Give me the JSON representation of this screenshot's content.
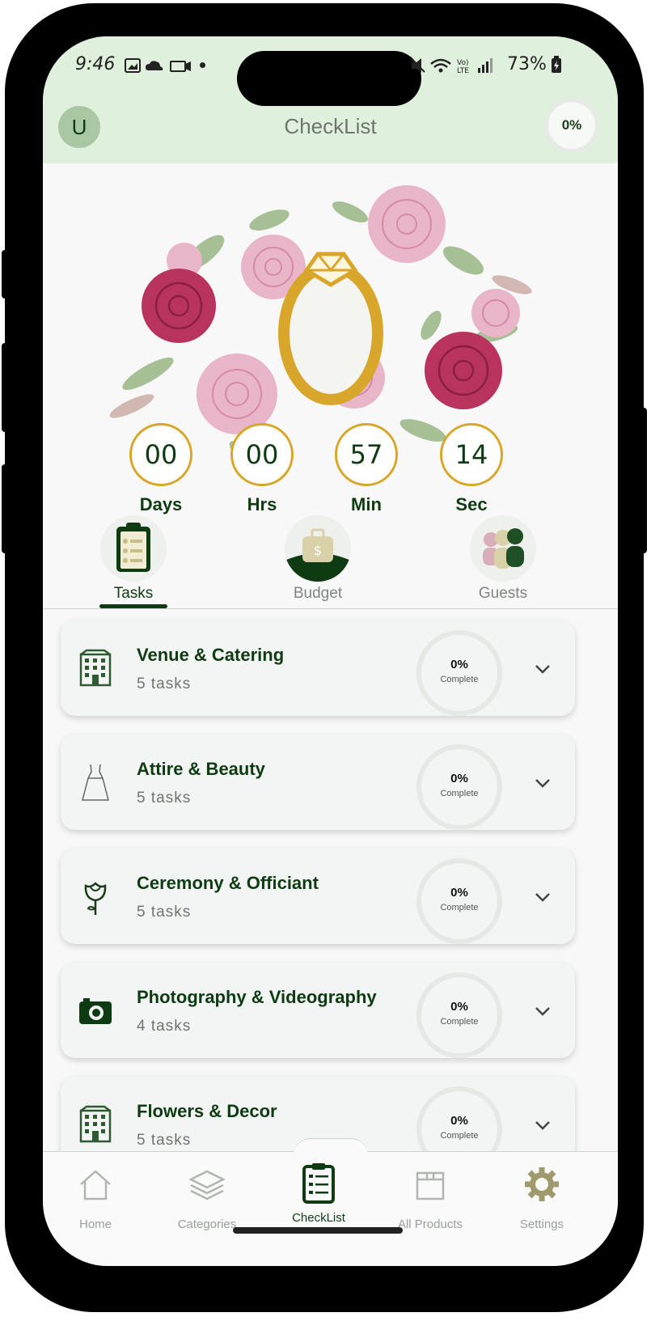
{
  "status_bar": {
    "time": "9:46",
    "battery": "73%"
  },
  "header": {
    "avatar_initial": "U",
    "title": "CheckList",
    "progress": "0%"
  },
  "countdown": [
    {
      "value": "00",
      "label": "Days"
    },
    {
      "value": "00",
      "label": "Hrs"
    },
    {
      "value": "57",
      "label": "Min"
    },
    {
      "value": "14",
      "label": "Sec"
    }
  ],
  "tabs": [
    {
      "label": "Tasks",
      "icon": "clipboard-icon",
      "active": true
    },
    {
      "label": "Budget",
      "icon": "money-bag-icon",
      "active": false
    },
    {
      "label": "Guests",
      "icon": "guests-icon",
      "active": false
    }
  ],
  "categories": [
    {
      "name": "Venue & Catering",
      "count": "5 tasks",
      "percent": "0%",
      "complete_label": "Complete",
      "icon": "building-icon"
    },
    {
      "name": "Attire & Beauty",
      "count": "5 tasks",
      "percent": "0%",
      "complete_label": "Complete",
      "icon": "dress-icon"
    },
    {
      "name": "Ceremony & Officiant",
      "count": "5 tasks",
      "percent": "0%",
      "complete_label": "Complete",
      "icon": "rose-icon"
    },
    {
      "name": "Photography & Videography",
      "count": "4 tasks",
      "percent": "0%",
      "complete_label": "Complete",
      "icon": "camera-icon"
    },
    {
      "name": "Flowers & Decor",
      "count": "5 tasks",
      "percent": "0%",
      "complete_label": "Complete",
      "icon": "building-icon"
    }
  ],
  "bottom_nav": [
    {
      "label": "Home",
      "icon": "home-icon"
    },
    {
      "label": "Categories",
      "icon": "layers-icon"
    },
    {
      "label": "CheckList",
      "icon": "clipboard-icon",
      "active": true
    },
    {
      "label": "All Products",
      "icon": "box-icon"
    },
    {
      "label": "Settings",
      "icon": "gear-icon"
    }
  ],
  "colors": {
    "primary": "#0f3b12",
    "header_bg": "#dff0dc",
    "gold": "#d8a62a",
    "rose": "#c04a72"
  }
}
